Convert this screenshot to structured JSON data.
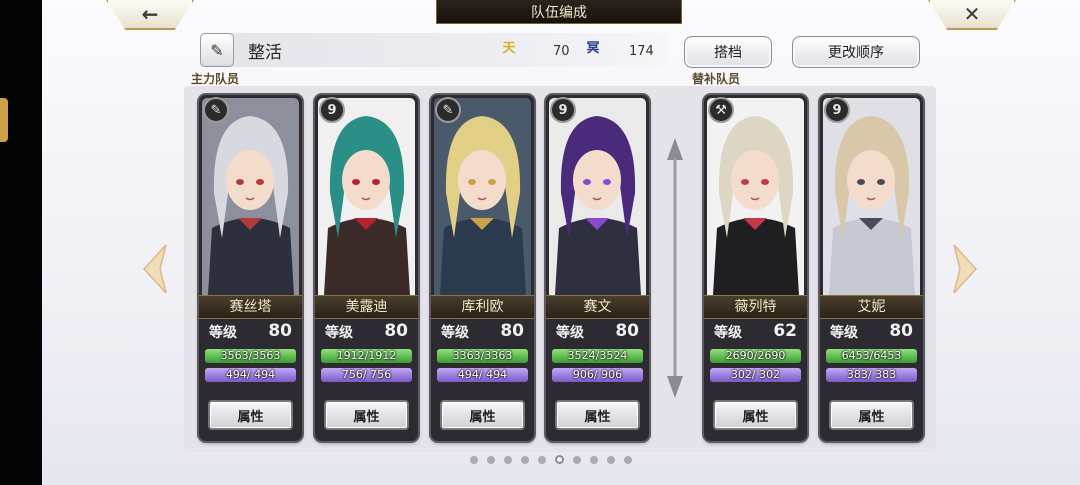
{
  "header": {
    "title": "队伍编成",
    "back_icon": "←",
    "close_icon": "✕"
  },
  "team": {
    "name": "整活",
    "stat1_icon": "天",
    "stat1_value": "70",
    "stat2_icon": "冥",
    "stat2_value": "174",
    "partner_label": "搭档",
    "reorder_label": "更改顺序"
  },
  "sections": {
    "main": "主力队员",
    "reserve": "替补队员"
  },
  "attr_label": "属性",
  "level_label": "等级",
  "members": [
    {
      "name": "赛丝塔",
      "level": "80",
      "hp": "3563/3563",
      "mp": "494/ 494",
      "icon": "✎",
      "hair": "#d8d8e0",
      "accent": "#b23a3a",
      "outfit": "#2d2f3c",
      "bg": "#8d8f9c"
    },
    {
      "name": "美露迪",
      "level": "80",
      "hp": "1912/1912",
      "mp": "756/ 756",
      "icon": "9",
      "hair": "#2a8f86",
      "accent": "#b5232d",
      "outfit": "#3a2a2a",
      "bg": "#f0f0f0"
    },
    {
      "name": "库利欧",
      "level": "80",
      "hp": "3363/3363",
      "mp": "494/ 494",
      "icon": "✎",
      "hair": "#e2cf86",
      "accent": "#c9a24a",
      "outfit": "#2b3a4c",
      "bg": "#4a5a6a"
    },
    {
      "name": "赛文",
      "level": "80",
      "hp": "3524/3524",
      "mp": "906/ 906",
      "icon": "9",
      "hair": "#4a2a7a",
      "accent": "#8a4ad0",
      "outfit": "#2e3040",
      "bg": "#eaeaea"
    },
    {
      "name": "薇列特",
      "level": "62",
      "hp": "2690/2690",
      "mp": "302/ 302",
      "icon": "⚒",
      "hair": "#ddd6c4",
      "accent": "#c23a4a",
      "outfit": "#1f1f22",
      "bg": "#f2f2f2"
    },
    {
      "name": "艾妮",
      "level": "80",
      "hp": "6453/6453",
      "mp": "383/ 383",
      "icon": "9",
      "hair": "#d8c7a8",
      "accent": "#4a4a5a",
      "outfit": "#c6c8d2",
      "bg": "#dfe0e6"
    }
  ],
  "pager": {
    "count": 10,
    "active": 5
  }
}
